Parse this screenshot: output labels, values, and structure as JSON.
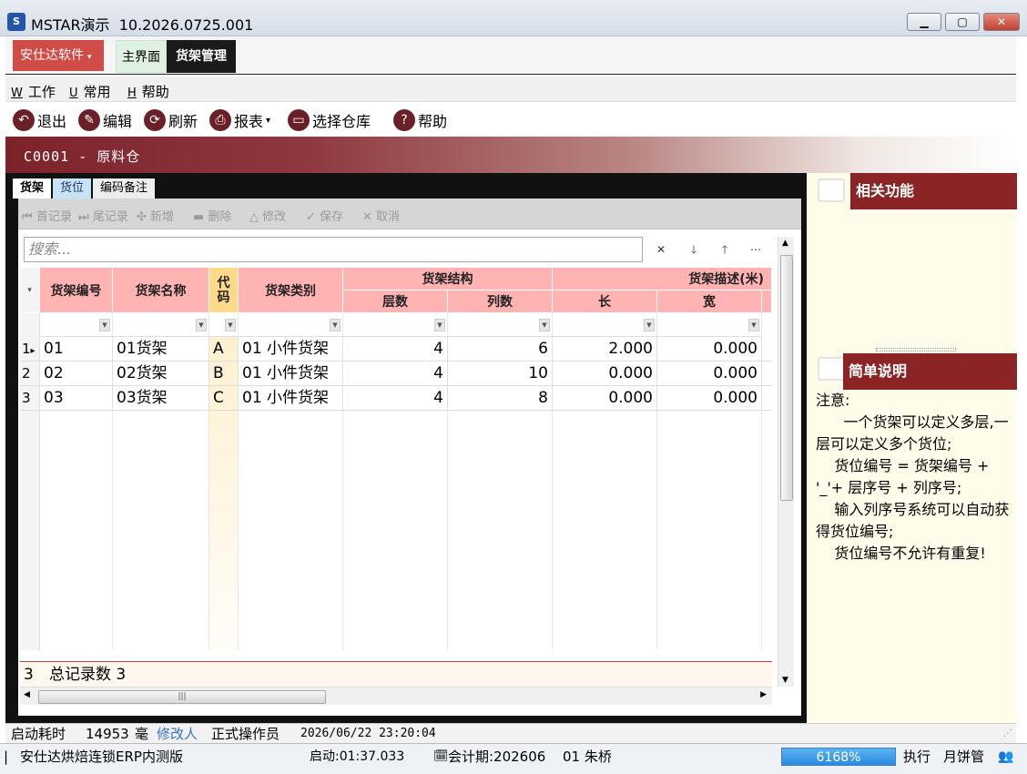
{
  "window": {
    "title": "MSTAR演示",
    "version": "10.2026.0725.001"
  },
  "topbar": {
    "company": "安仕达软件",
    "tabs": [
      "主界面",
      "货架管理"
    ]
  },
  "menu": [
    {
      "key": "W",
      "label": "工作"
    },
    {
      "key": "U",
      "label": "常用"
    },
    {
      "key": "H",
      "label": "帮助"
    }
  ],
  "toolbar": {
    "exit": "退出",
    "edit": "编辑",
    "refresh": "刷新",
    "report": "报表",
    "select_warehouse": "选择仓库",
    "help": "帮助"
  },
  "banner": {
    "title": "C0001 - 原料仓"
  },
  "inner_tabs": [
    "货架",
    "货位",
    "编码备注"
  ],
  "nav": {
    "first": "首记录",
    "last": "尾记录",
    "add": "新增",
    "delete": "删除",
    "modify": "修改",
    "save": "保存",
    "cancel": "取消"
  },
  "search": {
    "placeholder": "搜索..."
  },
  "grid": {
    "headers": {
      "code": "货架编号",
      "name": "货架名称",
      "short": "代码",
      "type": "货架类别",
      "structure": "货架结构",
      "layers": "层数",
      "columns": "列数",
      "desc": "货架描述(米)",
      "length": "长",
      "width": "宽"
    },
    "rows": [
      {
        "idx": "1",
        "code": "01",
        "name": "01货架",
        "short": "A",
        "type": "01 小件货架",
        "layers": "4",
        "columns": "6",
        "length": "2.000",
        "width": "0.000"
      },
      {
        "idx": "2",
        "code": "02",
        "name": "02货架",
        "short": "B",
        "type": "01 小件货架",
        "layers": "4",
        "columns": "10",
        "length": "0.000",
        "width": "0.000"
      },
      {
        "idx": "3",
        "code": "03",
        "name": "03货架",
        "short": "C",
        "type": "01 小件货架",
        "layers": "4",
        "columns": "8",
        "length": "0.000",
        "width": "0.000"
      }
    ],
    "footer_count": "3",
    "footer_label": "总记录数 3"
  },
  "right": {
    "related_title": "相关功能",
    "notes_title": "简单说明",
    "notes": "注意:\n      一个货架可以定义多层,一层可以定义多个货位;\n    货位编号 = 货架编号 + '_'+ 层序号 + 列序号;\n    输入列序号系统可以自动获得货位编号;\n    货位编号不允许有重复!"
  },
  "status": {
    "startup_label": "启动耗时",
    "startup_value": "14953",
    "startup_unit": "毫",
    "modifier_label": "修改人",
    "operator": "正式操作员",
    "datetime": "2026/06/22 23:20:04",
    "company_version": "安仕达烘焙连锁ERP内测版",
    "boot_time": "启动:01:37.033",
    "accounting_period": "会计期:202606",
    "user": "01 朱桥",
    "progress": "6168%",
    "execute": "执行",
    "user_role": "月饼管"
  }
}
